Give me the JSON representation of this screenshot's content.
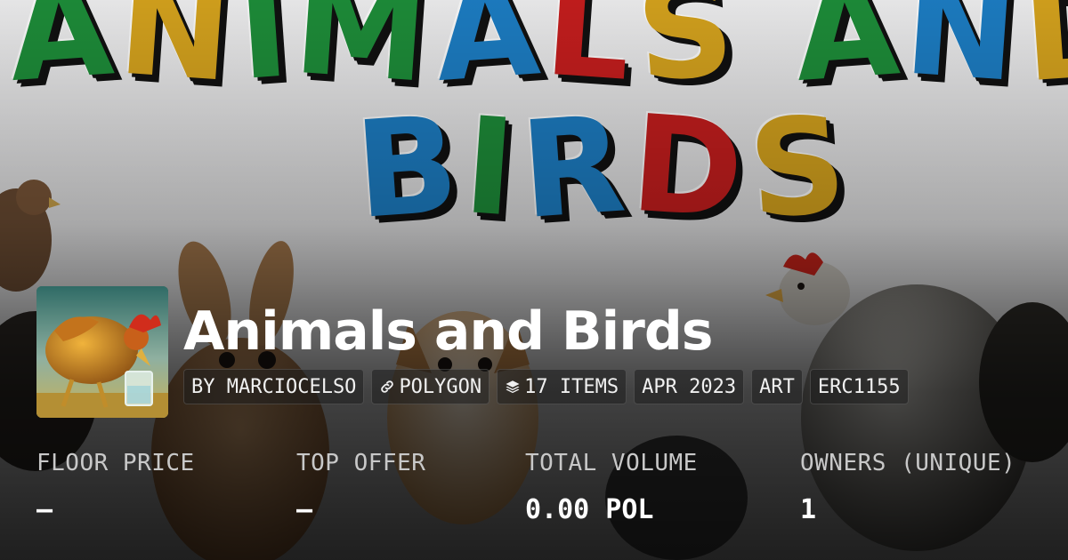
{
  "banner": {
    "title_line1": [
      "A",
      "N",
      "I",
      "M",
      "A",
      "L",
      "S",
      " ",
      "A",
      "N",
      "D"
    ],
    "title_line2": [
      "B",
      "I",
      "R",
      "D",
      "S"
    ],
    "colors": {
      "green": "#1e8f3a",
      "yellow": "#d8a51e",
      "blue": "#1d7fc6",
      "red": "#c81e1e",
      "shadow": "#111111",
      "sky": "#e9e9ea"
    }
  },
  "collection": {
    "avatar_icon": "rooster-drinking-icon",
    "name": "Animals and Birds"
  },
  "tags": [
    {
      "label": "BY MARCIOCELSO",
      "icon": ""
    },
    {
      "label": "POLYGON",
      "icon": "link-icon"
    },
    {
      "label": "17 ITEMS",
      "icon": "layers-icon"
    },
    {
      "label": "APR 2023",
      "icon": ""
    },
    {
      "label": "ART",
      "icon": ""
    },
    {
      "label": "ERC1155",
      "icon": ""
    }
  ],
  "stats": [
    {
      "label": "FLOOR PRICE",
      "value": "–"
    },
    {
      "label": "TOP OFFER",
      "value": "–"
    },
    {
      "label": "TOTAL VOLUME",
      "value": "0.00 POL"
    },
    {
      "label": "OWNERS (UNIQUE)",
      "value": "1"
    }
  ]
}
